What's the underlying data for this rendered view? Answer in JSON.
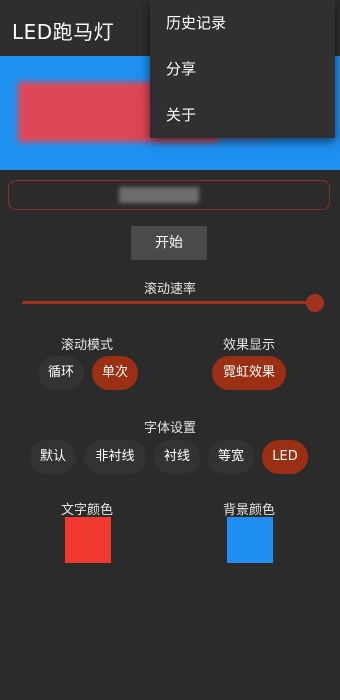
{
  "app": {
    "title": "LED跑马灯"
  },
  "menu": {
    "items": [
      "历史记录",
      "分享",
      "关于"
    ]
  },
  "banner": {
    "background": "#1e90f0",
    "text_color": "#ff3a3a"
  },
  "input": {
    "value": ""
  },
  "start_button": {
    "label": "开始"
  },
  "speed": {
    "label": "滚动速率",
    "value": 1.0
  },
  "scroll_mode": {
    "label": "滚动模式",
    "options": [
      "循环",
      "单次"
    ],
    "selected": "单次"
  },
  "effect": {
    "label": "效果显示",
    "options": [
      "霓虹效果"
    ],
    "selected": "霓虹效果"
  },
  "font": {
    "label": "字体设置",
    "options": [
      "默认",
      "非衬线",
      "衬线",
      "等宽",
      "LED"
    ],
    "selected": "LED"
  },
  "text_color": {
    "label": "文字颜色",
    "value": "#f03a2e"
  },
  "bg_color": {
    "label": "背景颜色",
    "value": "#1e8ff0"
  },
  "colors": {
    "accent": "#9a2f14",
    "background": "#2b2b2b"
  }
}
